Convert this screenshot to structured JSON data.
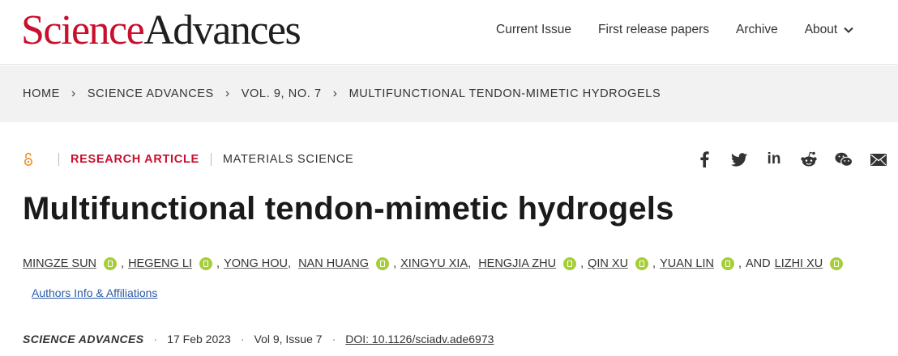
{
  "header": {
    "logo_science": "Science",
    "logo_advances": "Advances",
    "nav": [
      "Current Issue",
      "First release papers",
      "Archive",
      "About"
    ]
  },
  "breadcrumb": {
    "items": [
      "HOME",
      "SCIENCE ADVANCES",
      "VOL. 9, NO. 7",
      "MULTIFUNCTIONAL TENDON-MIMETIC HYDROGELS"
    ]
  },
  "article": {
    "type": "RESEARCH ARTICLE",
    "subject": "MATERIALS SCIENCE",
    "title": "Multifunctional tendon-mimetic hydrogels",
    "authors": [
      "MINGZE SUN",
      "HEGENG LI",
      "YONG HOU",
      "NAN HUANG",
      "XINGYU XIA",
      "HENGJIA ZHU",
      "QIN XU",
      "YUAN LIN",
      "LIZHI XU"
    ],
    "and_text": "AND",
    "affiliations_link": "Authors Info & Affiliations",
    "journal": "SCIENCE ADVANCES",
    "date": "17 Feb 2023",
    "volume": "Vol 9, Issue 7",
    "doi": "DOI: 10.1126/sciadv.ade6973"
  },
  "share_icons": [
    "facebook-icon",
    "twitter-icon",
    "linkedin-icon",
    "reddit-icon",
    "wechat-icon",
    "email-icon"
  ],
  "colors": {
    "brand_red": "#c8102e",
    "orcid_green": "#a6ce39",
    "link_blue": "#2b5aa8"
  }
}
